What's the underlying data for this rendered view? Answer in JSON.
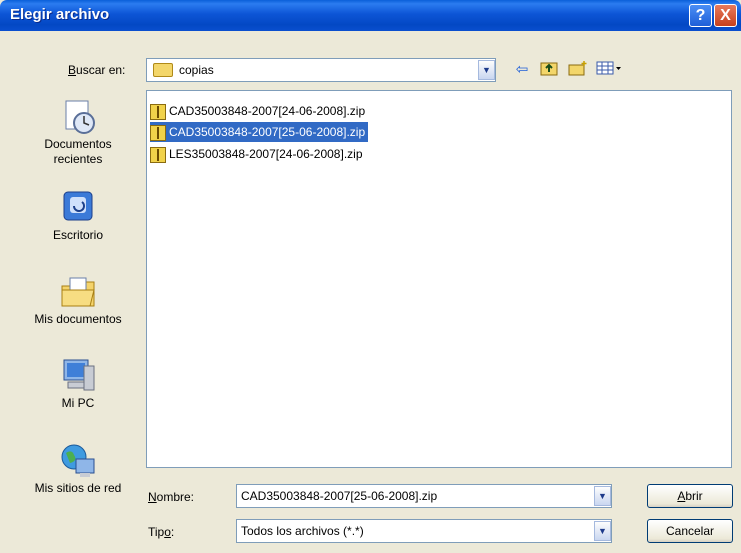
{
  "dialog": {
    "title": "Elegir archivo",
    "help_label": "?",
    "close_label": "X"
  },
  "lookin": {
    "label_access": "B",
    "label_rest": "uscar en:",
    "value": "copias"
  },
  "toolbar": {
    "back_icon": "back-arrow-icon",
    "up_icon": "up-folder-icon",
    "newfolder_icon": "new-folder-icon",
    "views_icon": "views-menu-icon"
  },
  "places": [
    {
      "label": "Documentos recientes",
      "icon": "recent-documents-icon"
    },
    {
      "label": "Escritorio",
      "icon": "desktop-icon"
    },
    {
      "label": "Mis documentos",
      "icon": "my-documents-icon"
    },
    {
      "label": "Mi PC",
      "icon": "my-computer-icon"
    },
    {
      "label": "Mis sitios de red",
      "icon": "network-places-icon"
    }
  ],
  "files": [
    {
      "name": "CAD35003848-2007[24-06-2008].zip",
      "selected": false
    },
    {
      "name": "CAD35003848-2007[25-06-2008].zip",
      "selected": true
    },
    {
      "name": "LES35003848-2007[24-06-2008].zip",
      "selected": false
    }
  ],
  "filename": {
    "label_access": "N",
    "label_rest": "ombre:",
    "value": "CAD35003848-2007[25-06-2008].zip"
  },
  "filetype": {
    "label_pre": "Tip",
    "label_access": "o",
    "label_rest": ":",
    "value": "Todos los archivos (*.*)"
  },
  "buttons": {
    "open_access": "A",
    "open_rest": "brir",
    "cancel": "Cancelar"
  },
  "colors": {
    "titlebar": "#0348c4",
    "selection": "#316ac5",
    "face": "#ece9d8"
  }
}
